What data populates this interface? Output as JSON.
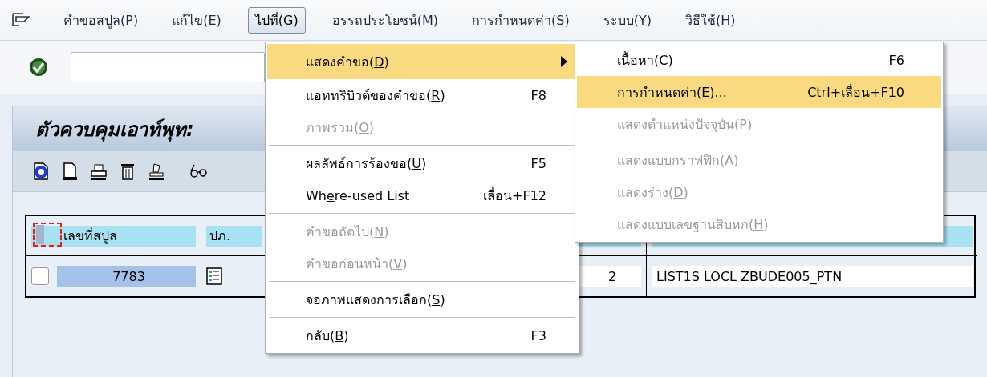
{
  "menubar": {
    "items": [
      {
        "label": "คำขอสปูล(",
        "key": "P",
        "tail": ")",
        "selected": false
      },
      {
        "label": "แก้ไข(",
        "key": "E",
        "tail": ")",
        "selected": false
      },
      {
        "label": "ไปที่(",
        "key": "G",
        "tail": ")",
        "selected": true
      },
      {
        "label": "อรรถประโยชน์(",
        "key": "M",
        "tail": ")",
        "selected": false
      },
      {
        "label": "การกำหนดค่า(",
        "key": "S",
        "tail": ")",
        "selected": false
      },
      {
        "label": "ระบบ(",
        "key": "Y",
        "tail": ")",
        "selected": false
      },
      {
        "label": "วิธีใช้(",
        "key": "H",
        "tail": ")",
        "selected": false
      }
    ]
  },
  "panel": {
    "title": "ตัวควบคุมเอาท์พุท:"
  },
  "table": {
    "columns": [
      {
        "label": "เลขที่สปูล"
      },
      {
        "label": "ปภ."
      }
    ],
    "rows": [
      {
        "checked": false,
        "selected": true,
        "spool": "7783",
        "pages": "2",
        "title": "LIST1S LOCL ZBUDE005_PTN"
      }
    ]
  },
  "menu": {
    "items": [
      {
        "kind": "item",
        "label": "แสดงคำขอ(",
        "key": "D",
        "tail": ")",
        "submenu": true,
        "disabled": false,
        "selected": true
      },
      {
        "kind": "item",
        "label": "แอททริบิวต์ของคำขอ(",
        "key": "R",
        "tail": ")",
        "shortcut": "F8",
        "disabled": false,
        "selected": false
      },
      {
        "kind": "item",
        "label": "ภาพรวม(",
        "key": "O",
        "tail": ")",
        "disabled": true,
        "selected": false
      },
      {
        "kind": "separator"
      },
      {
        "kind": "item",
        "label": "ผลลัพธ์การร้องขอ(",
        "key": "U",
        "tail": ")",
        "shortcut": "F5",
        "disabled": false,
        "selected": false
      },
      {
        "kind": "item",
        "label": "Wh",
        "key": "e",
        "tail": "re-used List",
        "shortcut": "เลื่อน+F12",
        "disabled": false,
        "selected": false
      },
      {
        "kind": "separator"
      },
      {
        "kind": "item",
        "label": "คำขอถัดไป(",
        "key": "N",
        "tail": ")",
        "disabled": true,
        "selected": false
      },
      {
        "kind": "item",
        "label": "คำขอก่อนหน้า(",
        "key": "V",
        "tail": ")",
        "disabled": true,
        "selected": false
      },
      {
        "kind": "separator"
      },
      {
        "kind": "item",
        "label": "จอภาพแสดงการเลือก(",
        "key": "S",
        "tail": ")",
        "disabled": false,
        "selected": false
      },
      {
        "kind": "separator"
      },
      {
        "kind": "item",
        "label": "กลับ(",
        "key": "B",
        "tail": ")",
        "shortcut": "F3",
        "disabled": false,
        "selected": false
      }
    ]
  },
  "submenu": {
    "items": [
      {
        "kind": "item",
        "label": "เนื้อหา(",
        "key": "C",
        "tail": ")",
        "shortcut": "F6",
        "disabled": false,
        "selected": false
      },
      {
        "kind": "item",
        "label": "การกำหนดค่า(",
        "key": "E",
        "tail": ")...",
        "shortcut": "Ctrl+เลื่อน+F10",
        "disabled": false,
        "selected": true
      },
      {
        "kind": "item",
        "label": "แสดงตำแหน่งปัจจุบัน(",
        "key": "P",
        "tail": ")",
        "disabled": true,
        "selected": false
      },
      {
        "kind": "separator"
      },
      {
        "kind": "item",
        "label": "แสดงแบบกราฟฟิก(",
        "key": "A",
        "tail": ")",
        "disabled": true,
        "selected": false
      },
      {
        "kind": "item",
        "label": "แสดงร่าง(",
        "key": "D",
        "tail": ")",
        "disabled": true,
        "selected": false
      },
      {
        "kind": "item",
        "label": "แสดงแบบเลขฐานสิบหก(",
        "key": "H",
        "tail": ")",
        "disabled": true,
        "selected": false
      }
    ]
  }
}
